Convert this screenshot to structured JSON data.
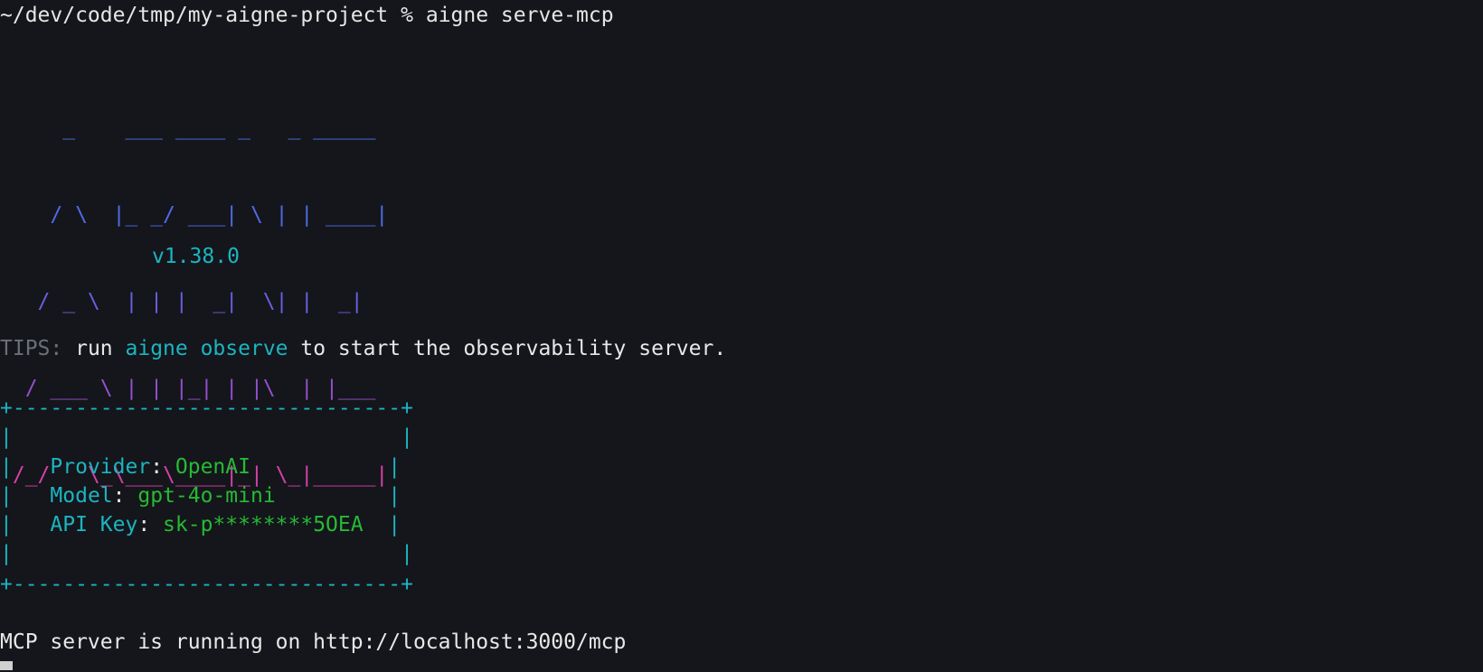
{
  "prompt": {
    "path": "~/dev/code/tmp/my-aigne-project",
    "symbol": "%",
    "command": "aigne serve-mcp"
  },
  "banner": {
    "lines": [
      {
        "text": "     _    ___ ____ _   _ _____",
        "color": "#4a74e0"
      },
      {
        "text": "    / \\  |_ _/ ___| \\ | | ____|",
        "color": "#4f6be6"
      },
      {
        "text": "   / _ \\  | | |  _|  \\| |  _|",
        "color": "#6a5fe2"
      },
      {
        "text": "  / ___ \\ | | |_| | |\\  | |___",
        "color": "#9450cf"
      },
      {
        "text": " /_/   \\_\\___\\____|_| \\_|_____|",
        "color": "#d840a8"
      }
    ],
    "version": "v1.38.0"
  },
  "tips": {
    "label": "TIPS:",
    "pre": " run ",
    "command": "aigne observe",
    "post": " to start the observability server."
  },
  "info_box": {
    "border_top": "+-------------------------------+",
    "empty_row": "|                               |",
    "left_edge": "|",
    "rows": [
      {
        "indent": "   ",
        "key": "Provider",
        "sep": ": ",
        "value": "OpenAI",
        "pad": "           |"
      },
      {
        "indent": "   ",
        "key": "Model",
        "sep": ": ",
        "value": "gpt-4o-mini",
        "pad": "         |"
      },
      {
        "indent": "   ",
        "key": "API Key",
        "sep": ": ",
        "value": "sk-p********5OEA",
        "pad": "  |"
      }
    ],
    "border_bottom": "+-------------------------------+"
  },
  "status": {
    "message": "MCP server is running on http://localhost:3000/mcp"
  },
  "colors": {
    "background": "#14161b",
    "cyan": "#1cb4c1",
    "green": "#28b935",
    "muted": "#6b6f76"
  }
}
